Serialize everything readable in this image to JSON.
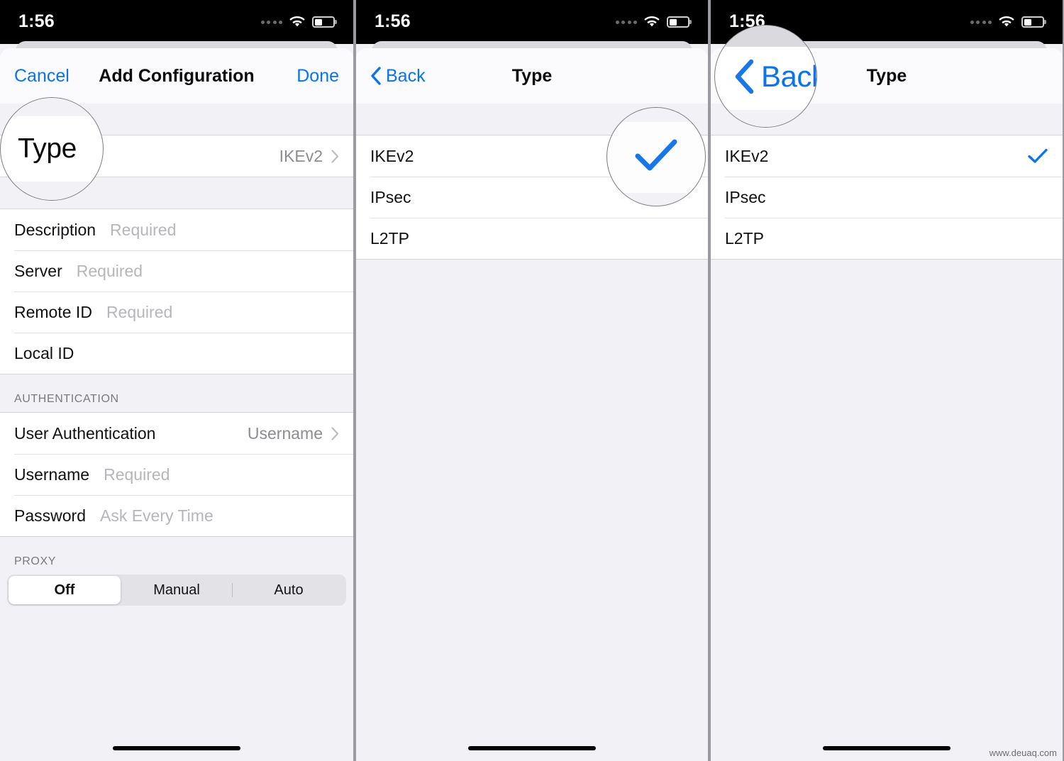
{
  "status_bar": {
    "time": "1:56",
    "signal_icon": "signal-dots-icon",
    "wifi_icon": "wifi-icon",
    "battery_icon": "battery-icon",
    "battery_level_pct": 40
  },
  "colors": {
    "accent_blue": "#0a74ef",
    "page_bg": "#f1f1f6",
    "row_bg": "#ffffff",
    "placeholder": "#b6b6bb"
  },
  "panel1": {
    "nav": {
      "cancel_label": "Cancel",
      "title": "Add Configuration",
      "done_label": "Done"
    },
    "type_row": {
      "label": "Type",
      "value": "IKEv2",
      "chevron_icon": "chevron-right-icon"
    },
    "fields": [
      {
        "label": "Description",
        "placeholder": "Required"
      },
      {
        "label": "Server",
        "placeholder": "Required"
      },
      {
        "label": "Remote ID",
        "placeholder": "Required"
      },
      {
        "label": "Local ID",
        "placeholder": ""
      }
    ],
    "auth_section": {
      "header": "AUTHENTICATION",
      "user_auth": {
        "label": "User Authentication",
        "value": "Username",
        "chevron_icon": "chevron-right-icon"
      },
      "fields": [
        {
          "label": "Username",
          "placeholder": "Required"
        },
        {
          "label": "Password",
          "placeholder": "Ask Every Time"
        }
      ]
    },
    "proxy_section": {
      "header": "PROXY",
      "options": [
        "Off",
        "Manual",
        "Auto"
      ],
      "selected": "Off"
    },
    "magnifier": {
      "text": "Type"
    }
  },
  "panel2": {
    "nav": {
      "back_label": "Back",
      "back_icon": "chevron-left-icon",
      "title": "Type"
    },
    "options": [
      {
        "label": "IKEv2",
        "selected": true
      },
      {
        "label": "IPsec",
        "selected": false
      },
      {
        "label": "L2TP",
        "selected": false
      }
    ],
    "check_icon": "checkmark-icon",
    "magnifier": {
      "icon": "checkmark-icon"
    }
  },
  "panel3": {
    "nav": {
      "back_label": "Back",
      "back_icon": "chevron-left-icon",
      "title": "Type"
    },
    "options": [
      {
        "label": "IKEv2",
        "selected": true
      },
      {
        "label": "IPsec",
        "selected": false
      },
      {
        "label": "L2TP",
        "selected": false
      }
    ],
    "check_icon": "checkmark-icon",
    "magnifier": {
      "text": "Back",
      "icon": "chevron-left-icon"
    }
  },
  "watermark": "www.deuaq.com"
}
